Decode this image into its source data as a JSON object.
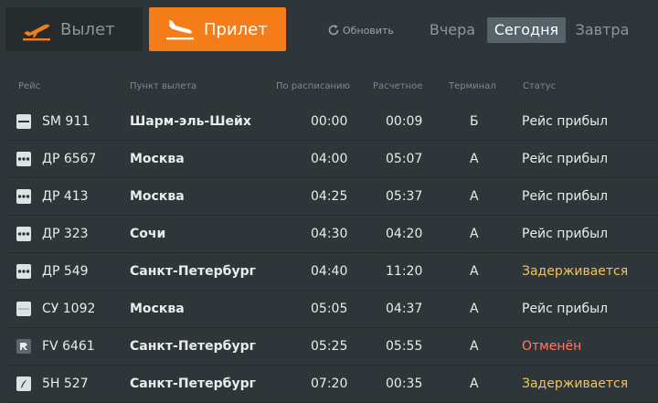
{
  "tabs": {
    "departures_label": "Вылет",
    "arrivals_label": "Прилет",
    "active": "arrivals"
  },
  "refresh_label": "Обновить",
  "days": {
    "yesterday": "Вчера",
    "today": "Сегодня",
    "tomorrow": "Завтра",
    "active": "today"
  },
  "columns": {
    "flight": "Рейс",
    "origin": "Пункт вылета",
    "scheduled": "По расписанию",
    "estimated": "Расчетное",
    "terminal": "Терминал",
    "status": "Статус"
  },
  "colors": {
    "accent": "#f47c19",
    "delayed": "#f2c25e",
    "cancelled": "#ff7a68"
  },
  "flights": [
    {
      "logo": "dash-logo",
      "flight": "SM 911",
      "origin": "Шарм-эль-Шейх",
      "scheduled": "00:00",
      "estimated": "00:09",
      "terminal": "Б",
      "status": "Рейс прибыл",
      "status_type": "arrived"
    },
    {
      "logo": "dots-logo",
      "flight": "ДР 6567",
      "origin": "Москва",
      "scheduled": "04:00",
      "estimated": "05:07",
      "terminal": "A",
      "status": "Рейс прибыл",
      "status_type": "arrived"
    },
    {
      "logo": "dots-logo",
      "flight": "ДР 413",
      "origin": "Москва",
      "scheduled": "04:25",
      "estimated": "05:37",
      "terminal": "A",
      "status": "Рейс прибыл",
      "status_type": "arrived"
    },
    {
      "logo": "dots-logo",
      "flight": "ДР 323",
      "origin": "Сочи",
      "scheduled": "04:30",
      "estimated": "04:20",
      "terminal": "A",
      "status": "Рейс прибыл",
      "status_type": "arrived"
    },
    {
      "logo": "dots-logo",
      "flight": "ДР 549",
      "origin": "Санкт-Петербург",
      "scheduled": "04:40",
      "estimated": "11:20",
      "terminal": "A",
      "status": "Задерживается",
      "status_type": "delayed"
    },
    {
      "logo": "line-logo",
      "flight": "СУ 1092",
      "origin": "Москва",
      "scheduled": "05:05",
      "estimated": "04:37",
      "terminal": "A",
      "status": "Рейс прибыл",
      "status_type": "arrived"
    },
    {
      "logo": "r-logo",
      "flight": "FV 6461",
      "origin": "Санкт-Петербург",
      "scheduled": "05:25",
      "estimated": "05:55",
      "terminal": "A",
      "status": "Отменён",
      "status_type": "cancelled"
    },
    {
      "logo": "feather-logo",
      "flight": "5H 527",
      "origin": "Санкт-Петербург",
      "scheduled": "07:20",
      "estimated": "00:35",
      "terminal": "A",
      "status": "Задерживается",
      "status_type": "delayed"
    }
  ]
}
